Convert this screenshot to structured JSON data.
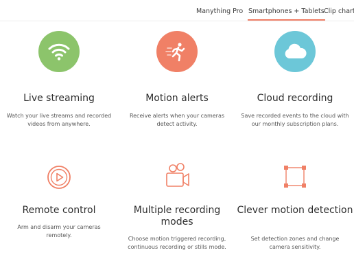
{
  "nav": {
    "tabs": [
      {
        "label": "Manything Pro",
        "active": false
      },
      {
        "label": "Smartphones + Tablets",
        "active": true
      },
      {
        "label": "Clip chart",
        "active": false
      }
    ],
    "accent_color": "#f07f66"
  },
  "features": [
    {
      "title": "Live streaming",
      "description": "Watch your live streams and recorded videos from anywhere.",
      "icon": "wifi-icon",
      "icon_color": "#8cc46b"
    },
    {
      "title": "Motion alerts",
      "description": "Receive alerts when your cameras detect activity.",
      "icon": "running-person-icon",
      "icon_color": "#f08066"
    },
    {
      "title": "Cloud recording",
      "description": "Save recorded events to the cloud with our monthly subscription plans.",
      "icon": "cloud-icon",
      "icon_color": "#6cc7d8"
    },
    {
      "title": "Remote control",
      "description": "Arm and disarm your cameras remotely.",
      "icon": "play-icon",
      "icon_color": "#f08066"
    },
    {
      "title": "Multiple recording modes",
      "description": "Choose motion triggered recording, continuous recording or stills mode.",
      "icon": "video-camera-icon",
      "icon_color": "#f08066"
    },
    {
      "title": "Clever motion detection",
      "description": "Set detection zones and change camera sensitivity.",
      "icon": "detection-zone-icon",
      "icon_color": "#f08066"
    }
  ]
}
